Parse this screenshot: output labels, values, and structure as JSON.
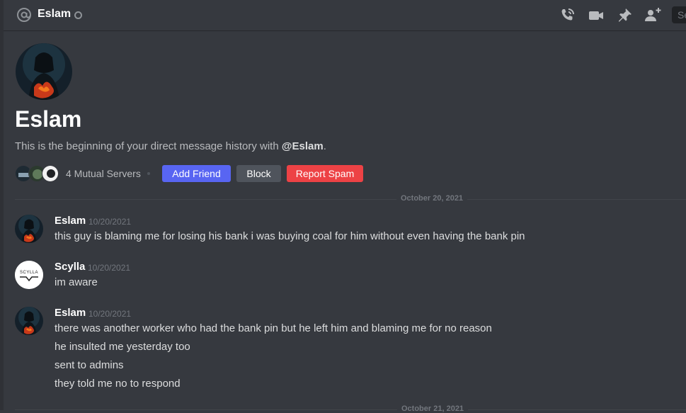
{
  "header": {
    "channel_name": "Eslam",
    "search_placeholder": "Se",
    "icons": [
      "at-icon",
      "status-offline-icon",
      "call-icon",
      "video-icon",
      "pin-icon",
      "add-member-icon"
    ]
  },
  "intro": {
    "name": "Eslam",
    "description_prefix": "This is the beginning of your direct message history with ",
    "description_mention": "@Eslam",
    "description_suffix": ".",
    "mutual_servers": "4 Mutual Servers",
    "add_friend_label": "Add Friend",
    "block_label": "Block",
    "report_spam_label": "Report Spam"
  },
  "dividers": [
    {
      "label": "October 20, 2021"
    },
    {
      "label": "October 21, 2021"
    }
  ],
  "messages": [
    {
      "author": "Eslam",
      "time": "10/20/2021",
      "lines": [
        "this guy is blaming me for losing his bank i was buying coal for him without even having the bank pin"
      ]
    },
    {
      "author": "Scylla",
      "time": "10/20/2021",
      "lines": [
        "im aware"
      ]
    },
    {
      "author": "Eslam",
      "time": "10/20/2021",
      "lines": [
        "there was another worker who had the bank pin but he left him and blaming me for no reason",
        "he insulted me yesterday too",
        "sent to admins",
        "they told me no to respond"
      ]
    }
  ],
  "colors": {
    "background": "#36393f",
    "blurple": "#5865f2",
    "danger": "#ed4245",
    "secondary": "#4f545c"
  }
}
